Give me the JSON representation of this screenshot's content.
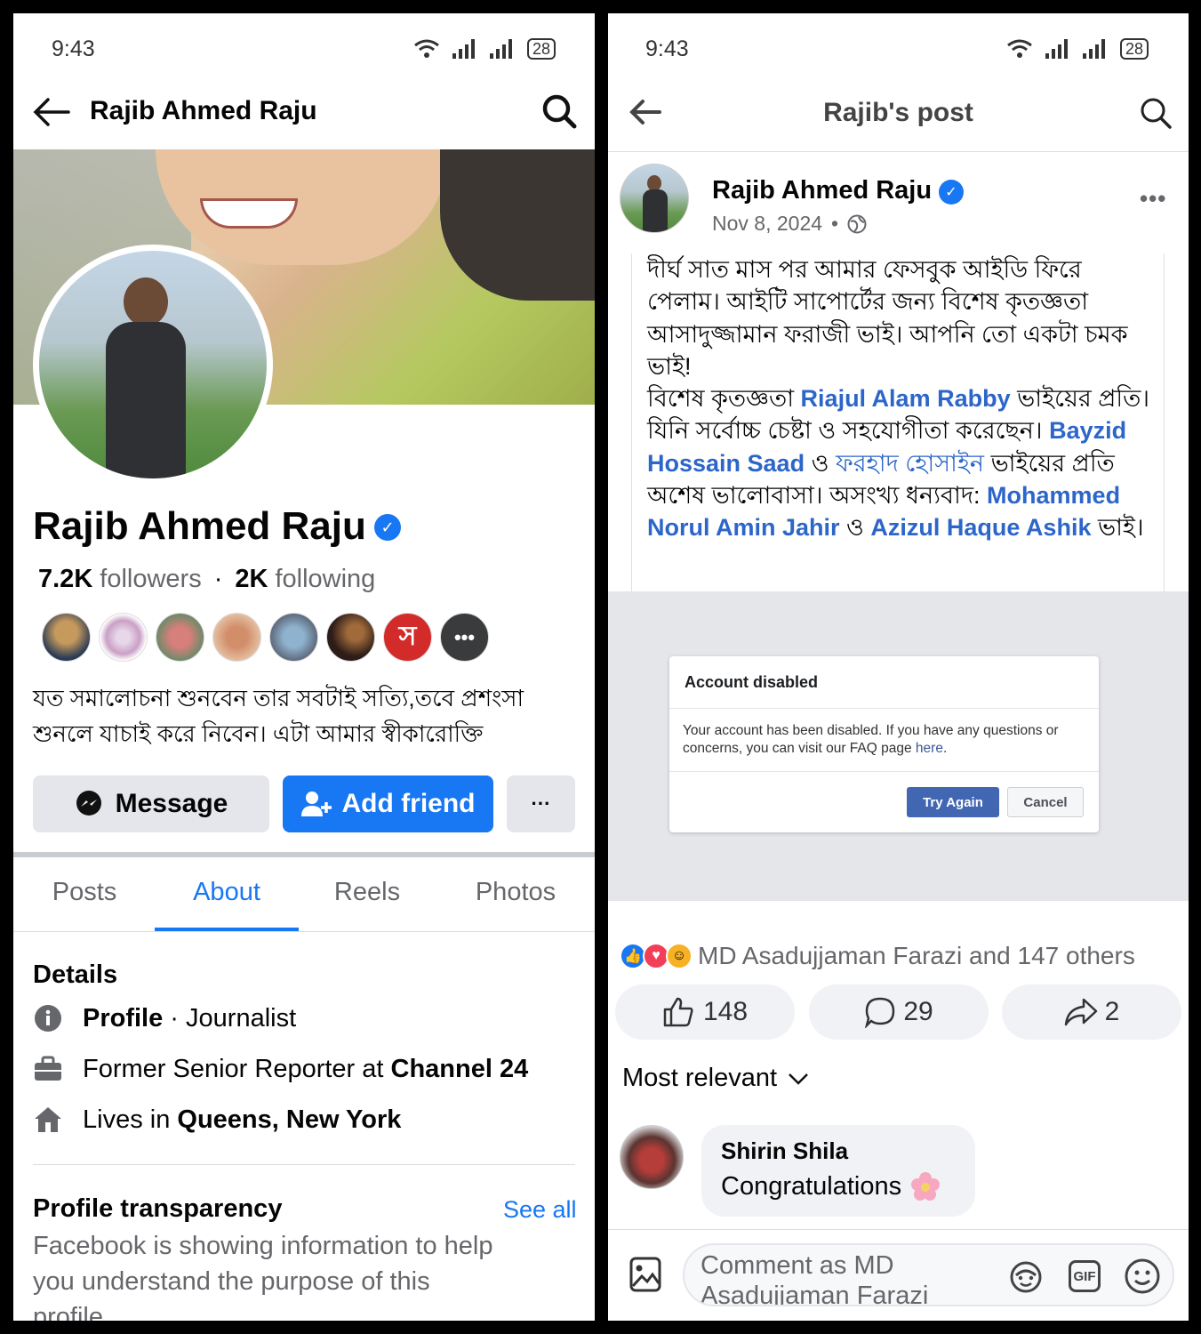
{
  "status": {
    "time": "9:43",
    "battery": "28"
  },
  "left": {
    "header_title": "Rajib Ahmed Raju",
    "profile_name": "Rajib Ahmed Raju",
    "followers_count": "7.2K",
    "followers_label": "followers",
    "dot": "·",
    "following_count": "2K",
    "following_label": "following",
    "bio": "যত সমালোচনা শুনবেন তার সবটাই সত্যি,তবে প্রশংসা শুনলে যাচাই করে নিবেন। এটা আমার স্বীকারোক্তি",
    "buttons": {
      "message": "Message",
      "add_friend": "Add friend",
      "more": "···"
    },
    "friend_avatar_letter": "স",
    "tabs": [
      "Posts",
      "About",
      "Reels",
      "Photos"
    ],
    "details": {
      "heading": "Details",
      "profile_label": "Profile",
      "profile_sep": " · ",
      "profile_value": "Journalist",
      "work_prefix": "Former Senior Reporter at ",
      "work_place": "Channel 24",
      "lives_prefix": "Lives in ",
      "lives_place": "Queens, New York"
    },
    "transparency": {
      "heading": "Profile transparency",
      "see_all": "See all",
      "text": "Facebook is showing information to help you understand the purpose of this profile"
    }
  },
  "right": {
    "header_title": "Rajib's post",
    "author": "Rajib Ahmed Raju",
    "date": "Nov 8, 2024",
    "date_sep": "•",
    "post": {
      "p1": "দীর্ঘ সাত মাস পর আমার ফেসবুক আইডি ফিরে পেলাম। আইটি সাপোর্টের জন্য বিশেষ কৃতজ্ঞতা আসাদুজ্জামান ফরাজী ভাই। আপনি তো একটা চমক ভাই!",
      "t1": "বিশেষ কৃতজ্ঞতা ",
      "m1": "Riajul Alam Rabby",
      "t2": " ভাইয়ের প্রতি। যিনি সর্বোচ্চ চেষ্টা ও সহযোগীতা করেছেন। ",
      "m2": "Bayzid Hossain Saad",
      "t3": " ও ",
      "m3": "ফরহাদ হোসাইন",
      "t4": " ভাইয়ের প্রতি অশেষ ভালোবাসা। অসংখ্য ধন্যবাদ: ",
      "m4": "Mohammed Norul Amin Jahir",
      "t5": " ও ",
      "m5": "Azizul Haque Ashik",
      "t6": " ভাই।"
    },
    "dialog": {
      "title": "Account disabled",
      "body": "Your account has been disabled. If you have any questions or concerns, you can visit our FAQ page ",
      "link": "here",
      "period": ".",
      "try_again": "Try Again",
      "cancel": "Cancel"
    },
    "reactions_text": "MD Asadujjaman Farazi and 147 others",
    "likes": "148",
    "comments": "29",
    "shares": "2",
    "sort_label": "Most relevant",
    "comment": {
      "author": "Shirin Shila",
      "text": "Congratulations"
    },
    "comment_placeholder": "Comment as MD Asadujjaman Farazi",
    "gif_label": "GIF"
  },
  "colors": {
    "accent": "#1877f2",
    "mention": "#2d66c9",
    "grey_button": "#e4e6eb"
  },
  "icons": [
    "wifi-icon",
    "signal-icon",
    "back-arrow-icon",
    "search-icon",
    "verified-icon",
    "messenger-icon",
    "add-friend-icon",
    "info-icon",
    "briefcase-icon",
    "home-icon",
    "globe-icon",
    "like-icon",
    "comment-icon",
    "share-icon",
    "photo-icon",
    "avatar-sticker-icon",
    "gif-icon",
    "emoji-icon"
  ]
}
